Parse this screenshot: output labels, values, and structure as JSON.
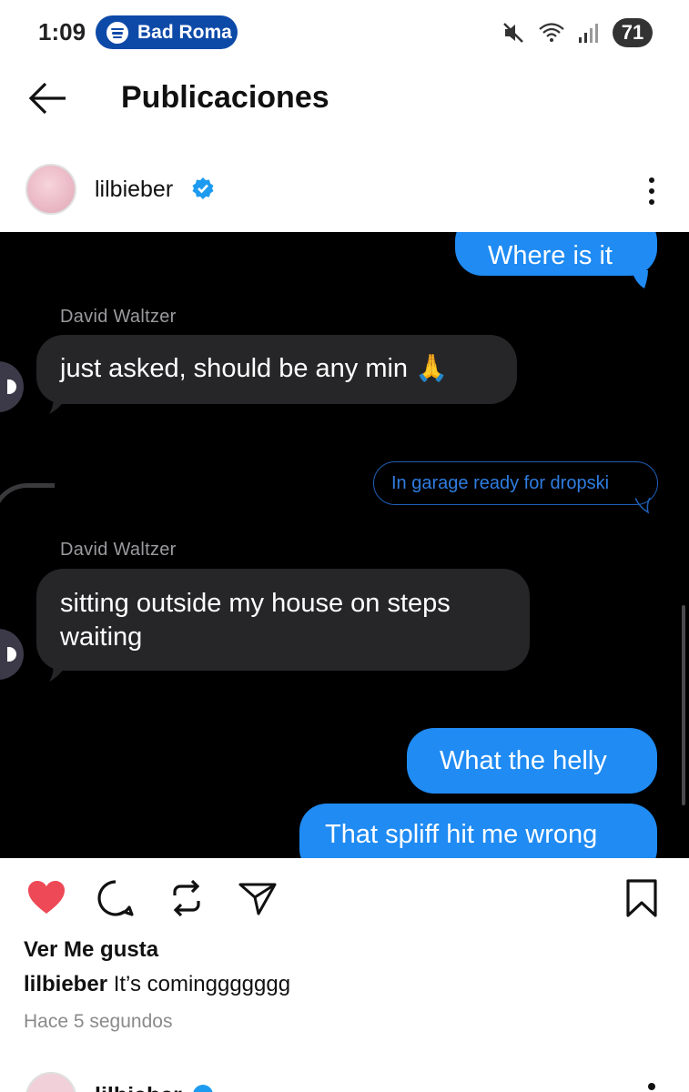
{
  "status_bar": {
    "time": "1:09",
    "spotify_label": "Bad Roma",
    "battery": "71",
    "accent": "#0d4aa8"
  },
  "header": {
    "title": "Publicaciones",
    "back_icon": "arrow-left-icon"
  },
  "post": {
    "username": "lilbieber",
    "verified_color": "#1d9bf0",
    "chat": {
      "messages": [
        {
          "from": "me",
          "text": "Where is it"
        },
        {
          "from": "other",
          "sender": "David Waltzer",
          "text": "just asked, should be any min 🙏"
        },
        {
          "from": "me_outline",
          "text": "In garage ready for dropski"
        },
        {
          "from": "other",
          "sender": "David Waltzer",
          "text_line1": "sitting outside my house on steps",
          "text_line2": "waiting"
        },
        {
          "from": "me",
          "text": "What the helly"
        },
        {
          "from": "me",
          "text": "That spliff hit me wrong"
        }
      ],
      "outgoing_color": "#1f8bf3",
      "incoming_color": "#262628"
    },
    "likes_label": "Ver Me gusta",
    "caption_user": "lilbieber",
    "caption_text": "It’s cominggggggg",
    "timestamp": "Hace 5 segundos",
    "like_color": "#ed4956"
  },
  "next_post": {
    "username": "lilbieber"
  }
}
